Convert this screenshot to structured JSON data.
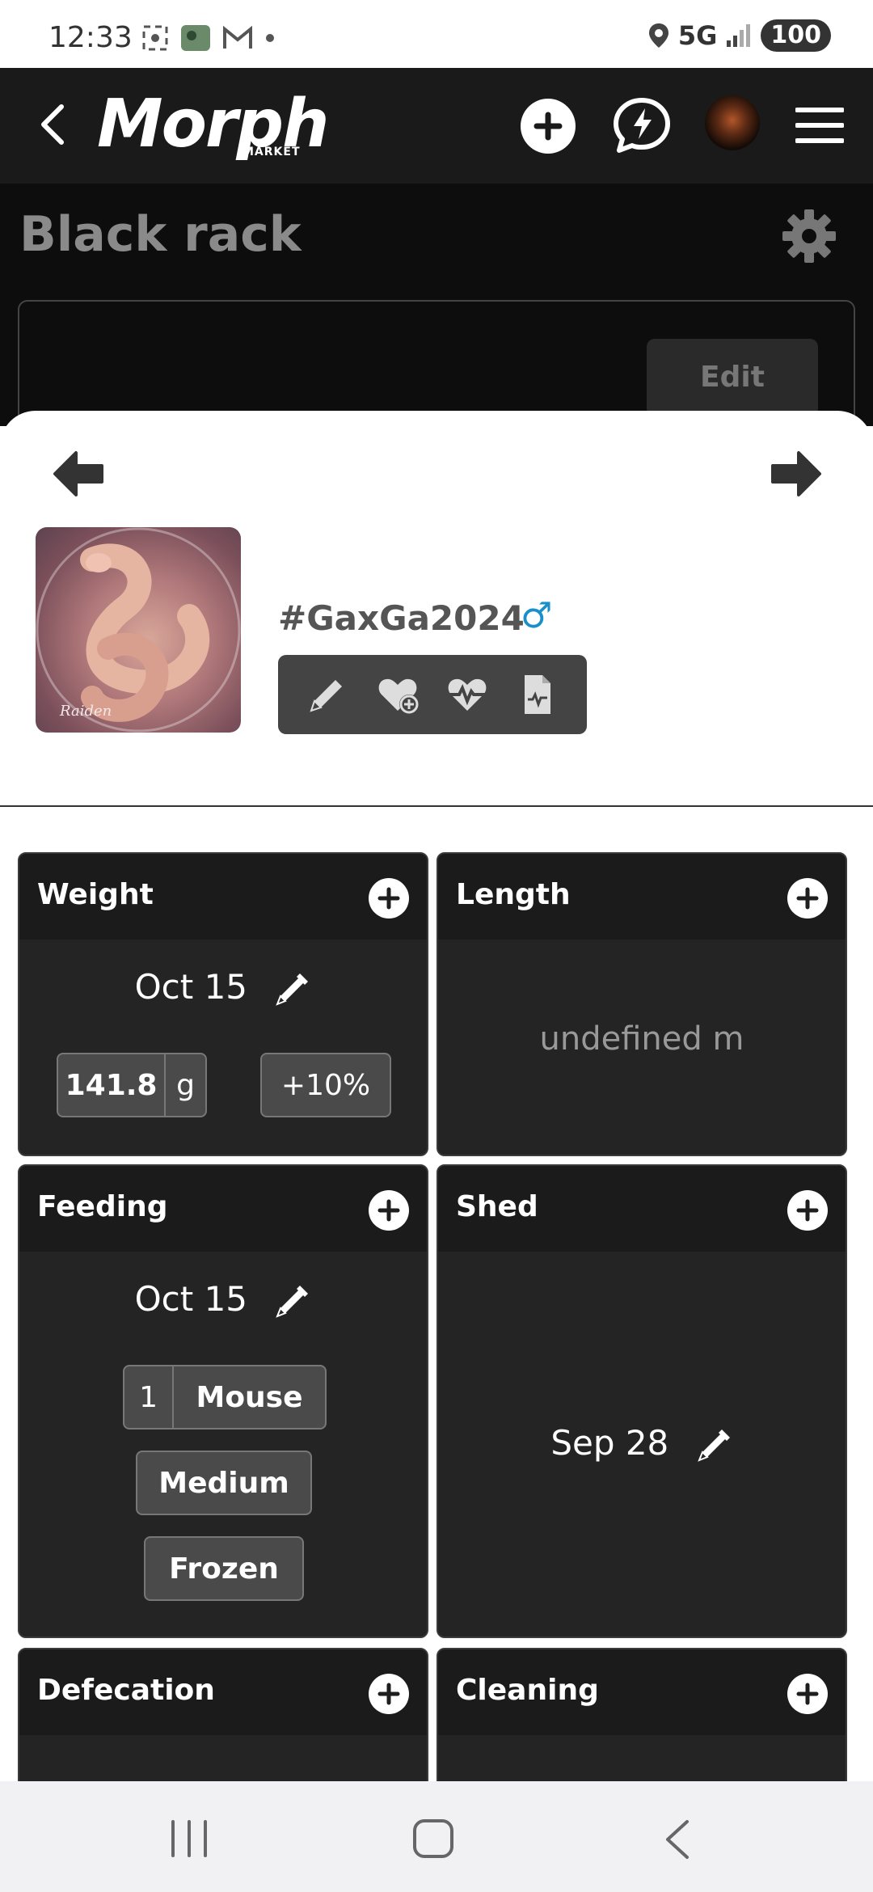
{
  "status_bar": {
    "time": "12:33",
    "network": "5G",
    "battery": "100"
  },
  "header": {
    "logo_text": "Morph",
    "logo_subtext": "MARKET"
  },
  "background_page": {
    "title": "Black rack",
    "edit_label": "Edit"
  },
  "animal": {
    "id": "#GaxGa2024",
    "gender_symbol": "♂",
    "photo_watermark": "Raiden"
  },
  "tiles": {
    "weight": {
      "title": "Weight",
      "date": "Oct 15",
      "value": "141.8",
      "unit": "g",
      "change": "+10%"
    },
    "length": {
      "title": "Length",
      "value": "undefined m"
    },
    "feeding": {
      "title": "Feeding",
      "date": "Oct 15",
      "quantity": "1",
      "prey": "Mouse",
      "size": "Medium",
      "state": "Frozen"
    },
    "shed": {
      "title": "Shed",
      "date": "Sep 28"
    },
    "defecation": {
      "title": "Defecation"
    },
    "cleaning": {
      "title": "Cleaning"
    }
  },
  "colors": {
    "header_bg": "#1a1a1a",
    "tile_bg": "#1e1e1e",
    "gender_blue": "#1a8fc9"
  }
}
